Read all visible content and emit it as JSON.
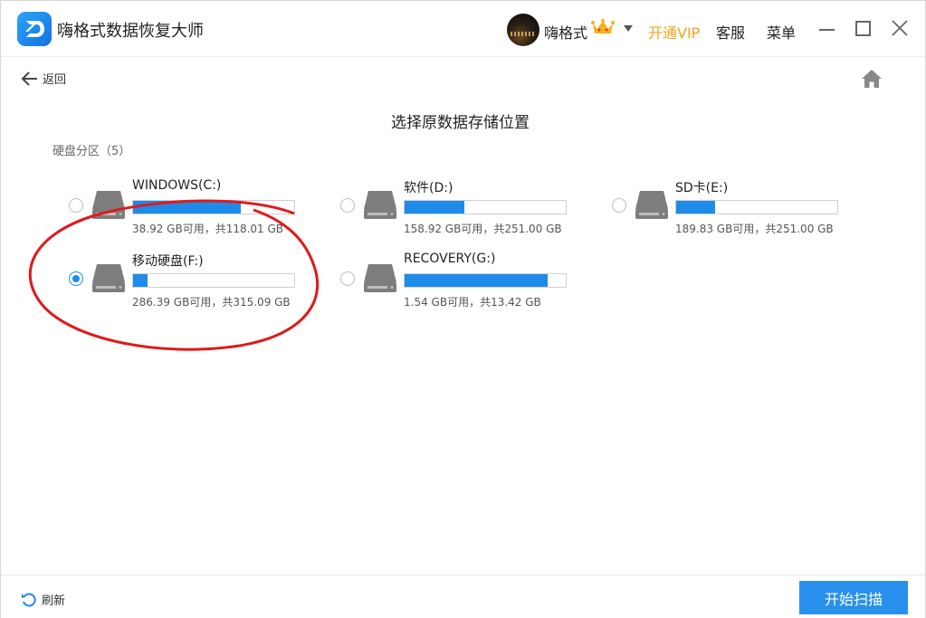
{
  "app": {
    "title": "嗨格式数据恢复大师"
  },
  "header": {
    "username": "嗨格式",
    "vip_label": "开通VIP",
    "service_label": "客服",
    "menu_label": "菜单"
  },
  "nav": {
    "back_label": "返回"
  },
  "main": {
    "title": "选择原数据存储位置",
    "section_label": "硬盘分区（5）",
    "drives": [
      {
        "name": "WINDOWS(C:)",
        "size_text": "38.92 GB可用，共118.01 GB",
        "used_fraction": 0.67,
        "selected": false
      },
      {
        "name": "软件(D:)",
        "size_text": "158.92 GB可用，共251.00 GB",
        "used_fraction": 0.37,
        "selected": false
      },
      {
        "name": "SD卡(E:)",
        "size_text": "189.83 GB可用，共251.00 GB",
        "used_fraction": 0.24,
        "selected": false
      },
      {
        "name": "移动硬盘(F:)",
        "size_text": "286.39 GB可用，共315.09 GB",
        "used_fraction": 0.09,
        "selected": true
      },
      {
        "name": "RECOVERY(G:)",
        "size_text": "1.54 GB可用，共13.42 GB",
        "used_fraction": 0.885,
        "selected": false
      }
    ]
  },
  "footer": {
    "refresh_label": "刷新",
    "scan_label": "开始扫描"
  },
  "colors": {
    "accent": "#1e8be8",
    "vip": "#f3a11b",
    "annotation": "#e0191a"
  }
}
